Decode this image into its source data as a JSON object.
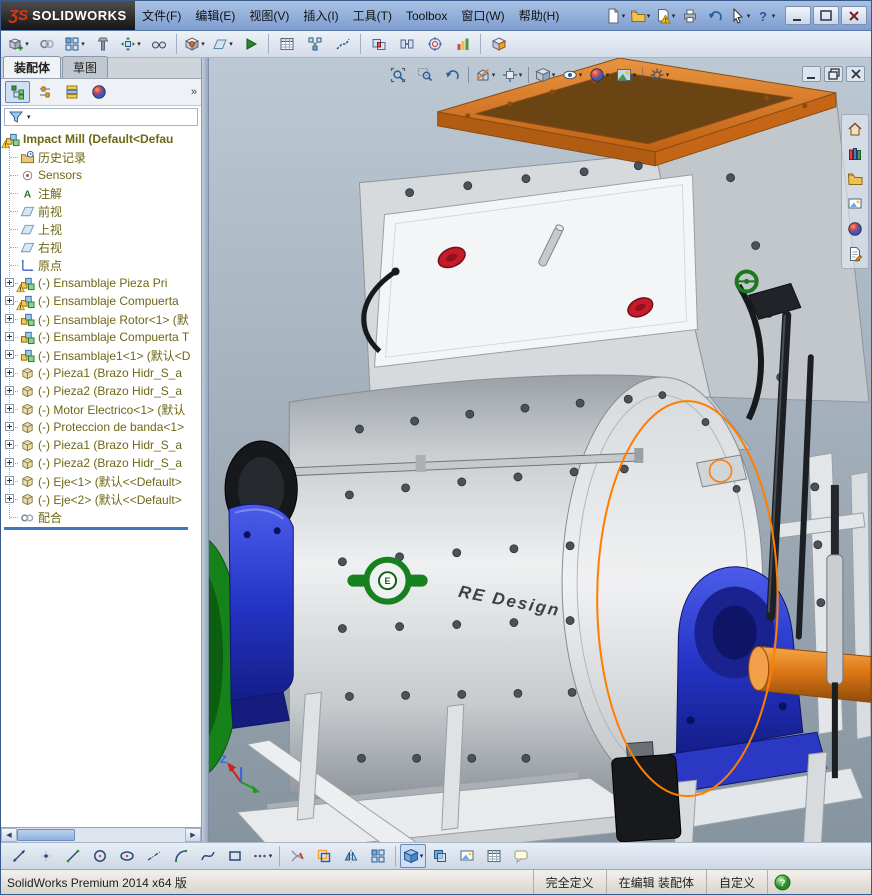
{
  "titlebar": {
    "logo_mark": "ƷS",
    "logo_text": "SOLIDWORKS",
    "menus": [
      {
        "name": "file",
        "label": "文件(F)"
      },
      {
        "name": "edit",
        "label": "编辑(E)"
      },
      {
        "name": "view",
        "label": "视图(V)"
      },
      {
        "name": "insert",
        "label": "插入(I)"
      },
      {
        "name": "tools",
        "label": "工具(T)"
      },
      {
        "name": "toolbox",
        "label": "Toolbox"
      },
      {
        "name": "window",
        "label": "窗口(W)"
      },
      {
        "name": "help",
        "label": "帮助(H)"
      }
    ],
    "quick_actions": [
      {
        "name": "new-document",
        "dd": true
      },
      {
        "name": "open",
        "dd": true
      },
      {
        "name": "save",
        "dd": true
      },
      {
        "name": "print"
      },
      {
        "name": "undo"
      },
      {
        "name": "select",
        "dd": true
      },
      {
        "name": "help",
        "dd": true
      }
    ],
    "window_controls": [
      {
        "name": "minimize"
      },
      {
        "name": "maximize"
      },
      {
        "name": "close"
      }
    ]
  },
  "toolbar": {
    "buttons": [
      {
        "name": "insert-components",
        "dd": true
      },
      {
        "name": "mate"
      },
      {
        "name": "linear-component-pattern",
        "dd": true
      },
      {
        "name": "smart-fasteners"
      },
      {
        "name": "move-component",
        "dd": true
      },
      {
        "name": "show-hidden-components"
      },
      {
        "sep": true
      },
      {
        "name": "assembly-features",
        "dd": true
      },
      {
        "name": "reference-geometry",
        "dd": true
      },
      {
        "name": "new-motion-study"
      },
      {
        "sep": true
      },
      {
        "name": "bill-of-materials"
      },
      {
        "name": "exploded-view"
      },
      {
        "name": "explode-line-sketch"
      },
      {
        "sep": true
      },
      {
        "name": "interference-detection"
      },
      {
        "name": "clearance-verification"
      },
      {
        "name": "hole-alignment"
      },
      {
        "name": "assembly-visualization"
      },
      {
        "sep": true
      },
      {
        "name": "instant-3d"
      }
    ]
  },
  "panel": {
    "tabs": [
      {
        "name": "assembly-tab",
        "label": "装配体",
        "active": true
      },
      {
        "name": "sketch-tab",
        "label": "草图",
        "active": false
      }
    ],
    "manager_tabs": [
      {
        "name": "feature-manager",
        "pressed": true
      },
      {
        "name": "property-manager"
      },
      {
        "name": "configuration-manager"
      },
      {
        "name": "display-manager"
      }
    ],
    "overflow_glyph": "»",
    "tree": {
      "items": [
        {
          "icon": "assembly",
          "warn": true,
          "root": true,
          "label": "Impact Mill (Default<Defau"
        },
        {
          "icon": "history",
          "label": "历史记录"
        },
        {
          "icon": "sensors",
          "label": "Sensors"
        },
        {
          "icon": "annotations",
          "label": "注解"
        },
        {
          "icon": "plane",
          "label": "前视"
        },
        {
          "icon": "plane",
          "label": "上视"
        },
        {
          "icon": "plane",
          "label": "右视"
        },
        {
          "icon": "origin",
          "label": "原点"
        },
        {
          "icon": "assembly",
          "warn": true,
          "plus": true,
          "label": "(-) Ensamblaje Pieza Pri"
        },
        {
          "icon": "assembly",
          "warn": true,
          "plus": true,
          "label": "(-) Ensamblaje Compuerta"
        },
        {
          "icon": "assembly",
          "plus": true,
          "label": "(-) Ensamblaje Rotor<1> (默"
        },
        {
          "icon": "assembly",
          "plus": true,
          "label": "(-) Ensamblaje Compuerta T"
        },
        {
          "icon": "assembly",
          "plus": true,
          "label": "(-) Ensamblaje1<1> (默认<D"
        },
        {
          "icon": "part",
          "plus": true,
          "label": "(-) Pieza1 (Brazo Hidr_S_a"
        },
        {
          "icon": "part",
          "plus": true,
          "label": "(-) Pieza2 (Brazo Hidr_S_a"
        },
        {
          "icon": "part",
          "plus": true,
          "label": "(-) Motor Electrico<1> (默认"
        },
        {
          "icon": "part",
          "plus": true,
          "label": "(-) Proteccion de banda<1>"
        },
        {
          "icon": "part",
          "plus": true,
          "label": "(-) Pieza1 (Brazo Hidr_S_a"
        },
        {
          "icon": "part",
          "plus": true,
          "label": "(-) Pieza2 (Brazo Hidr_S_a"
        },
        {
          "icon": "part",
          "plus": true,
          "label": "(-) Eje<1> (默认<<Default>"
        },
        {
          "icon": "part",
          "plus": true,
          "label": "(-) Eje<2> (默认<<Default>"
        },
        {
          "icon": "mates",
          "label": "配合"
        }
      ]
    }
  },
  "viewport": {
    "headsup": [
      {
        "name": "zoom-to-fit"
      },
      {
        "name": "zoom-to-area"
      },
      {
        "name": "previous-view"
      },
      {
        "sep": true
      },
      {
        "name": "section-view",
        "dd": true
      },
      {
        "name": "view-orientation",
        "dd": true
      },
      {
        "sep": true
      },
      {
        "name": "display-style",
        "dd": true
      },
      {
        "name": "hide-show-items",
        "dd": true
      },
      {
        "name": "edit-appearance",
        "dd": true
      },
      {
        "name": "apply-scene",
        "dd": true
      },
      {
        "sep": true
      },
      {
        "name": "view-settings",
        "dd": true
      }
    ],
    "doc_controls": [
      {
        "name": "minimize-document"
      },
      {
        "name": "restore-document"
      },
      {
        "name": "close-document"
      }
    ],
    "task_pane": [
      {
        "name": "solidworks-resources"
      },
      {
        "name": "design-library"
      },
      {
        "name": "file-explorer"
      },
      {
        "name": "view-palette"
      },
      {
        "name": "appearances-scenes"
      },
      {
        "name": "custom-properties"
      }
    ],
    "model_label": "RE Design",
    "logo_letter": "E",
    "triad_label": "Z",
    "accent_colors": {
      "selection": "#ff7e00",
      "machine_orange": "#d2701e",
      "bearing_blue": "#2535c6",
      "pulley_green": "#15821a"
    }
  },
  "bottom_toolbar": {
    "buttons": [
      {
        "name": "smart-dimension"
      },
      {
        "name": "sketch-point"
      },
      {
        "name": "sketch-line"
      },
      {
        "name": "sketch-circle"
      },
      {
        "name": "sketch-ellipse"
      },
      {
        "name": "centerline"
      },
      {
        "name": "sketch-arc"
      },
      {
        "name": "sketch-spline"
      },
      {
        "name": "sketch-rectangle"
      },
      {
        "name": "more-sketch-tools",
        "dd": true
      },
      {
        "sep": true
      },
      {
        "name": "trim-entities"
      },
      {
        "name": "convert-entities"
      },
      {
        "name": "mirror-entities"
      },
      {
        "name": "linear-sketch-pattern"
      },
      {
        "sep": true
      },
      {
        "name": "edit-component",
        "pressed": true,
        "dd": true
      },
      {
        "name": "assembly-transparency"
      },
      {
        "name": "render-image"
      },
      {
        "name": "design-table"
      },
      {
        "name": "comment"
      }
    ]
  },
  "statusbar": {
    "left": "SolidWorks Premium 2014 x64 版",
    "cells": [
      {
        "name": "definition-status",
        "label": "完全定义"
      },
      {
        "name": "edit-mode-status",
        "label": "在编辑 装配体"
      },
      {
        "name": "custom-tab",
        "label": "自定义"
      }
    ]
  }
}
